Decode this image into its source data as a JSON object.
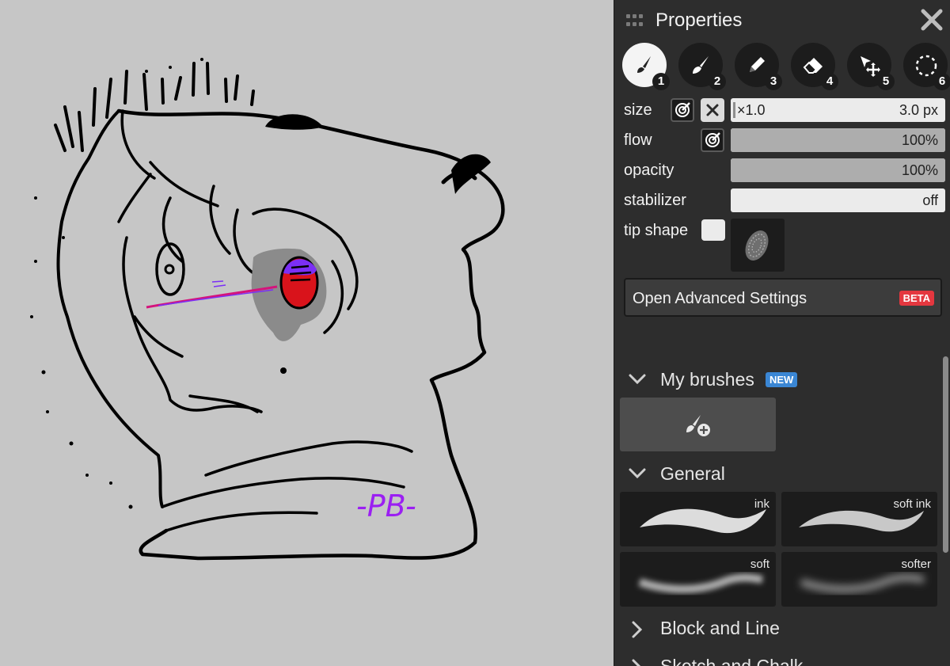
{
  "panel": {
    "title": "Properties",
    "tools": [
      {
        "number": "1",
        "icon": "brush-icon",
        "active": true
      },
      {
        "number": "2",
        "icon": "paint-brush-icon",
        "active": false
      },
      {
        "number": "3",
        "icon": "pencil-icon",
        "active": false
      },
      {
        "number": "4",
        "icon": "eraser-icon",
        "active": false
      },
      {
        "number": "5",
        "icon": "move-select-icon",
        "active": false
      },
      {
        "number": "6",
        "icon": "lasso-select-icon",
        "active": false
      }
    ],
    "properties": {
      "size": {
        "label": "size",
        "multiplier": "×1.0",
        "value": "3.0 px",
        "level": 0.01
      },
      "flow": {
        "label": "flow",
        "value": "100%",
        "level": 1.0
      },
      "opacity": {
        "label": "opacity",
        "value": "100%",
        "level": 1.0
      },
      "stabilizer": {
        "label": "stabilizer",
        "value": "off"
      },
      "tip_shape": {
        "label": "tip shape"
      }
    },
    "advanced": {
      "label": "Open Advanced Settings",
      "badge": "BETA"
    },
    "sections": {
      "my_brushes": {
        "label": "My brushes",
        "badge": "NEW",
        "expanded": true
      },
      "general": {
        "label": "General",
        "expanded": true
      },
      "block_and_line": {
        "label": "Block and Line",
        "expanded": false
      },
      "sketch_and_chalk": {
        "label": "Sketch and Chalk",
        "expanded": false
      }
    },
    "brushes": [
      {
        "name": "ink"
      },
      {
        "name": "soft ink"
      },
      {
        "name": "soft"
      },
      {
        "name": "softer"
      }
    ]
  },
  "canvas": {
    "signature": "-PB-"
  },
  "colors": {
    "canvas_bg": "#c6c6c6",
    "panel_bg": "#2d2d2d",
    "beta_badge": "#e4373f",
    "new_badge": "#3a86d4",
    "signature": "#9b1ff2",
    "eye_red": "#d9131b",
    "eye_purple": "#7b2ff5"
  }
}
